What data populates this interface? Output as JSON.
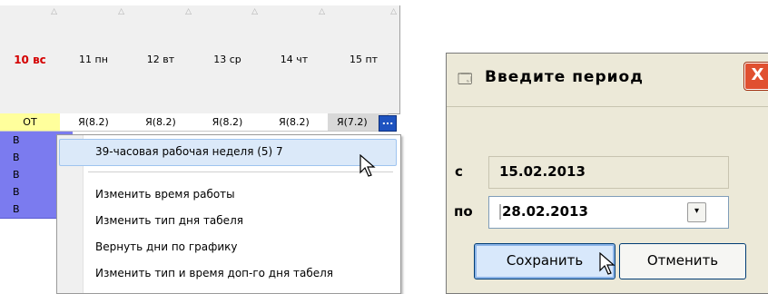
{
  "grid": {
    "headers": [
      {
        "label": "10 вс",
        "weekend": true
      },
      {
        "label": "11 пн",
        "weekend": false
      },
      {
        "label": "12 вт",
        "weekend": false
      },
      {
        "label": "13 ср",
        "weekend": false
      },
      {
        "label": "14 чт",
        "weekend": false
      },
      {
        "label": "15 пт",
        "weekend": false
      }
    ],
    "row1": [
      "ОТ",
      "Я(8.2)",
      "Я(8.2)",
      "Я(8.2)",
      "Я(8.2)",
      "Я(7.2)"
    ],
    "ellipsis_label": "...",
    "weekend_cells": [
      "В",
      "В",
      "В",
      "В",
      "В"
    ],
    "colors": {
      "weekend_header": "#d40000",
      "ot_cell": "#ffff9c",
      "weekend_cell": "#7b7bef",
      "ellipsis_btn": "#1e53c0"
    }
  },
  "context_menu": {
    "highlighted_item": "39-часовая рабочая неделя (5) 7",
    "items": [
      "Изменить время работы",
      "Изменить тип дня табеля",
      "Вернуть дни по графику",
      "Изменить тип и время доп-го дня табеля"
    ]
  },
  "dialog": {
    "title": "Введите период",
    "close_label": "X",
    "from_label": "с",
    "from_value": "15.02.2013",
    "to_label": "по",
    "to_value": "28.02.2013",
    "dropdown_icon": "chevron-down-icon",
    "save_label": "Сохранить",
    "cancel_label": "Отменить",
    "colors": {
      "close_button": "#e05030",
      "save_button": "#d8e8fb"
    }
  }
}
